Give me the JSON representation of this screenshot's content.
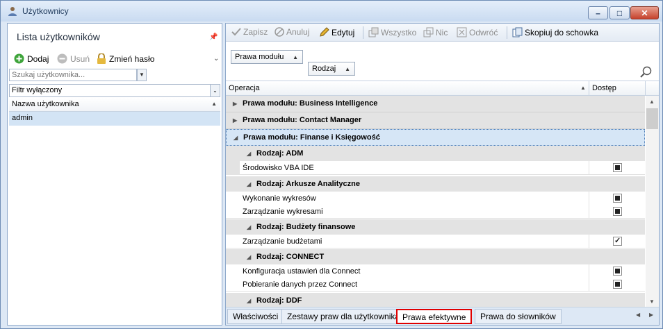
{
  "window": {
    "title": "Użytkownicy",
    "buttons": {
      "minimize": "–",
      "maximize": "□",
      "close": "✕"
    }
  },
  "left_panel": {
    "title": "Lista użytkowników",
    "toolbar": {
      "add": "Dodaj",
      "remove": "Usuń",
      "change_password": "Zmień hasło"
    },
    "search": {
      "placeholder": "Szukaj użytkownika..."
    },
    "filter": {
      "value": "Filtr wyłączony"
    },
    "column_header": "Nazwa użytkownika",
    "users": [
      "admin"
    ]
  },
  "right_panel": {
    "toolbar": {
      "save": "Zapisz",
      "cancel": "Anuluj",
      "edit": "Edytuj",
      "all": "Wszystko",
      "none": "Nic",
      "invert": "Odwróć",
      "copy": "Skopiuj do schowka"
    },
    "group_chips": {
      "module": "Prawa modułu",
      "kind": "Rodzaj"
    },
    "grid_header": {
      "operation": "Operacja",
      "access": "Dostęp"
    },
    "rows": [
      {
        "type": "group1",
        "label": "Prawa modułu: Business Intelligence",
        "expanded": false
      },
      {
        "type": "group1",
        "label": "Prawa modułu: Contact Manager",
        "expanded": false
      },
      {
        "type": "group1",
        "label": "Prawa modułu: Finanse i Księgowość",
        "expanded": true,
        "selected": true
      },
      {
        "type": "group2",
        "label": "Rodzaj: ADM"
      },
      {
        "type": "item",
        "label": "Środowisko VBA IDE",
        "access": "indeterminate"
      },
      {
        "type": "group2",
        "label": "Rodzaj: Arkusze Analityczne"
      },
      {
        "type": "item",
        "label": "Wykonanie wykresów",
        "access": "indeterminate"
      },
      {
        "type": "item",
        "label": "Zarządzanie wykresami",
        "access": "indeterminate"
      },
      {
        "type": "group2",
        "label": "Rodzaj: Budżety finansowe"
      },
      {
        "type": "item",
        "label": "Zarządzanie budżetami",
        "access": "checked"
      },
      {
        "type": "group2",
        "label": "Rodzaj: CONNECT"
      },
      {
        "type": "item",
        "label": "Konfiguracja ustawień dla Connect",
        "access": "indeterminate"
      },
      {
        "type": "item",
        "label": "Pobieranie danych przez Connect",
        "access": "indeterminate"
      },
      {
        "type": "group2",
        "label": "Rodzaj: DDF"
      }
    ],
    "tabs": [
      {
        "label": "Właściwości"
      },
      {
        "label": "Zestawy praw dla użytkownika"
      },
      {
        "label": "Prawa efektywne",
        "active": true
      },
      {
        "label": "Prawa do słowników"
      }
    ]
  },
  "colors": {
    "accent": "#e00000",
    "selection": "#d3e4f5",
    "border": "#8fa9cb"
  }
}
